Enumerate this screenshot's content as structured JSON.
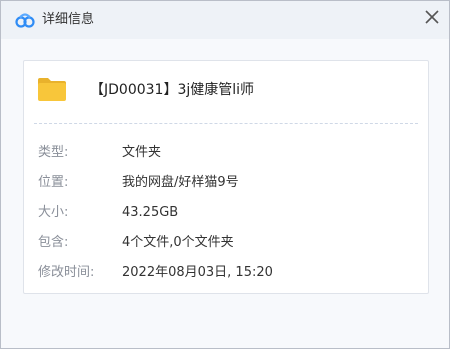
{
  "window": {
    "title": "详细信息",
    "close_icon": "close-icon",
    "logo_icon": "baidu-netdisk-logo"
  },
  "file": {
    "icon": "folder-icon",
    "name": "【JD00031】3j健康管li师"
  },
  "details": {
    "type_label": "类型:",
    "type_value": "文件夹",
    "location_label": "位置:",
    "location_value": "我的网盘/好样猫9号",
    "size_label": "大小:",
    "size_value": "43.25GB",
    "contains_label": "包含:",
    "contains_value": "4个文件,0个文件夹",
    "modified_label": "修改时间:",
    "modified_value": "2022年08月03日, 15:20"
  },
  "colors": {
    "folder": "#f8c63a",
    "logo_blue": "#2f8cf5"
  }
}
